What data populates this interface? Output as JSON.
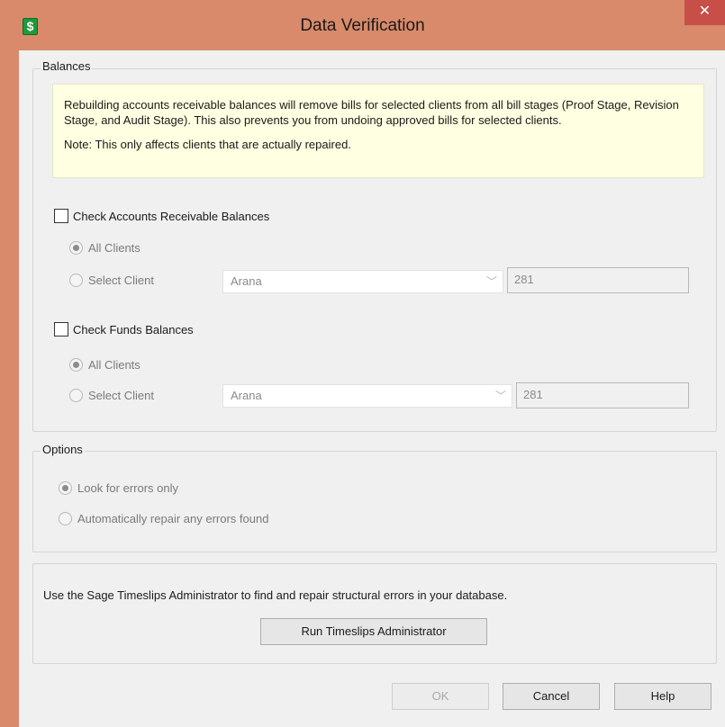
{
  "window": {
    "title": "Data Verification",
    "app_icon": "dollar-icon",
    "close_glyph": "✕"
  },
  "balances": {
    "group_label": "Balances",
    "info_text": "Rebuilding accounts receivable balances will remove bills for selected clients from all bill stages (Proof Stage, Revision Stage, and Audit Stage). This also prevents you from undoing approved bills for selected clients.",
    "note_text": "Note: This only affects clients that are actually repaired.",
    "ar": {
      "checkbox_label": "Check Accounts Receivable Balances",
      "checked": false,
      "all_clients_label": "All Clients",
      "select_client_label": "Select Client",
      "selected_option": "All Clients",
      "client_value": "Arana",
      "client_number": "281"
    },
    "funds": {
      "checkbox_label": "Check Funds Balances",
      "checked": false,
      "all_clients_label": "All Clients",
      "select_client_label": "Select Client",
      "selected_option": "All Clients",
      "client_value": "Arana",
      "client_number": "281"
    }
  },
  "options": {
    "group_label": "Options",
    "look_label": "Look for errors only",
    "repair_label": "Automatically repair any errors found",
    "selected_option": "Look for errors only"
  },
  "admin": {
    "text": "Use the Sage Timeslips Administrator to find and repair structural errors in your database.",
    "button_label": "Run Timeslips Administrator"
  },
  "footer": {
    "ok_label": "OK",
    "cancel_label": "Cancel",
    "help_label": "Help"
  },
  "colors": {
    "frame": "#d98a6a",
    "close": "#c74f47",
    "info_bg": "#ffffe1"
  }
}
